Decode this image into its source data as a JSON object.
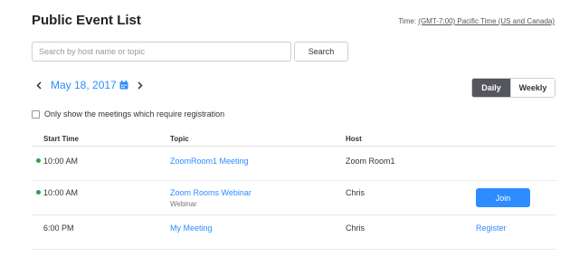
{
  "header": {
    "title": "Public Event List",
    "timezone_label": "Time:",
    "timezone_value": "(GMT-7:00) Pacific Time (US and Canada)"
  },
  "search": {
    "placeholder": "Search by host name or topic",
    "value": "",
    "button_label": "Search"
  },
  "date_nav": {
    "date": "May 18, 2017",
    "prev_icon": "chevron-left-icon",
    "next_icon": "chevron-right-icon",
    "calendar_icon": "calendar-icon"
  },
  "view_toggle": {
    "options": [
      "Daily",
      "Weekly"
    ],
    "selected": "Daily"
  },
  "filter": {
    "label": "Only show the meetings which require registration",
    "checked": false
  },
  "table": {
    "columns": [
      "Start Time",
      "Topic",
      "Host"
    ],
    "rows": [
      {
        "live": true,
        "start_time": "10:00 AM",
        "topic": "ZoomRoom1 Meeting",
        "topic_sub": "",
        "host": "Zoom Room1",
        "action": ""
      },
      {
        "live": true,
        "start_time": "10:00 AM",
        "topic": "Zoom Rooms Webinar",
        "topic_sub": "Webinar",
        "host": "Chris",
        "action": "Join"
      },
      {
        "live": false,
        "start_time": "6:00 PM",
        "topic": "My Meeting",
        "topic_sub": "",
        "host": "Chris",
        "action": "Register"
      }
    ]
  },
  "colors": {
    "accent": "#2d8cff",
    "live_dot": "#2aa34a",
    "toggle_active": "#54555e"
  }
}
